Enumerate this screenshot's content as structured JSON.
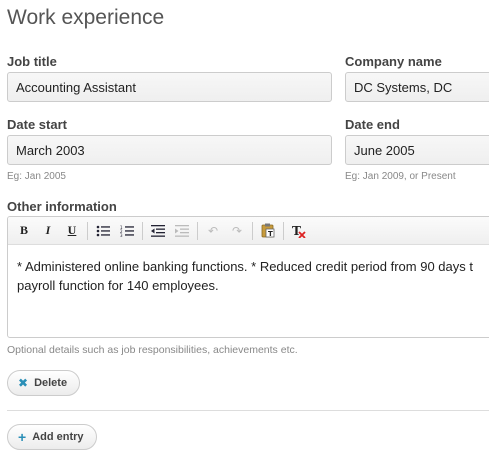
{
  "section": {
    "title": "Work experience"
  },
  "job_title": {
    "label": "Job title",
    "value": "Accounting Assistant"
  },
  "company_name": {
    "label": "Company name",
    "value": "DC Systems, DC"
  },
  "date_start": {
    "label": "Date start",
    "value": "March 2003",
    "hint": "Eg: Jan 2005"
  },
  "date_end": {
    "label": "Date end",
    "value": "June 2005",
    "hint": "Eg: Jan 2009, or Present"
  },
  "other_info": {
    "label": "Other information",
    "line1": "* Administered online banking functions. * Reduced credit period from 90 days t",
    "line2": "payroll function for 140 employees.",
    "hint": "Optional details such as job responsibilities, achievements etc."
  },
  "toolbar": {
    "bold": "B",
    "italic": "I",
    "underline": "U",
    "bulleted_list": "☰",
    "numbered_list": "☷",
    "outdent": "⇤",
    "indent": "⇥",
    "undo": "↶",
    "redo": "↷",
    "paste_text": "📋",
    "remove_format": "T̶"
  },
  "icons": {
    "delete": "close-icon",
    "add": "plus-icon"
  },
  "colors": {
    "accent": "#2a8fb7"
  },
  "buttons": {
    "delete_label": "Delete",
    "add_label": "Add entry"
  }
}
